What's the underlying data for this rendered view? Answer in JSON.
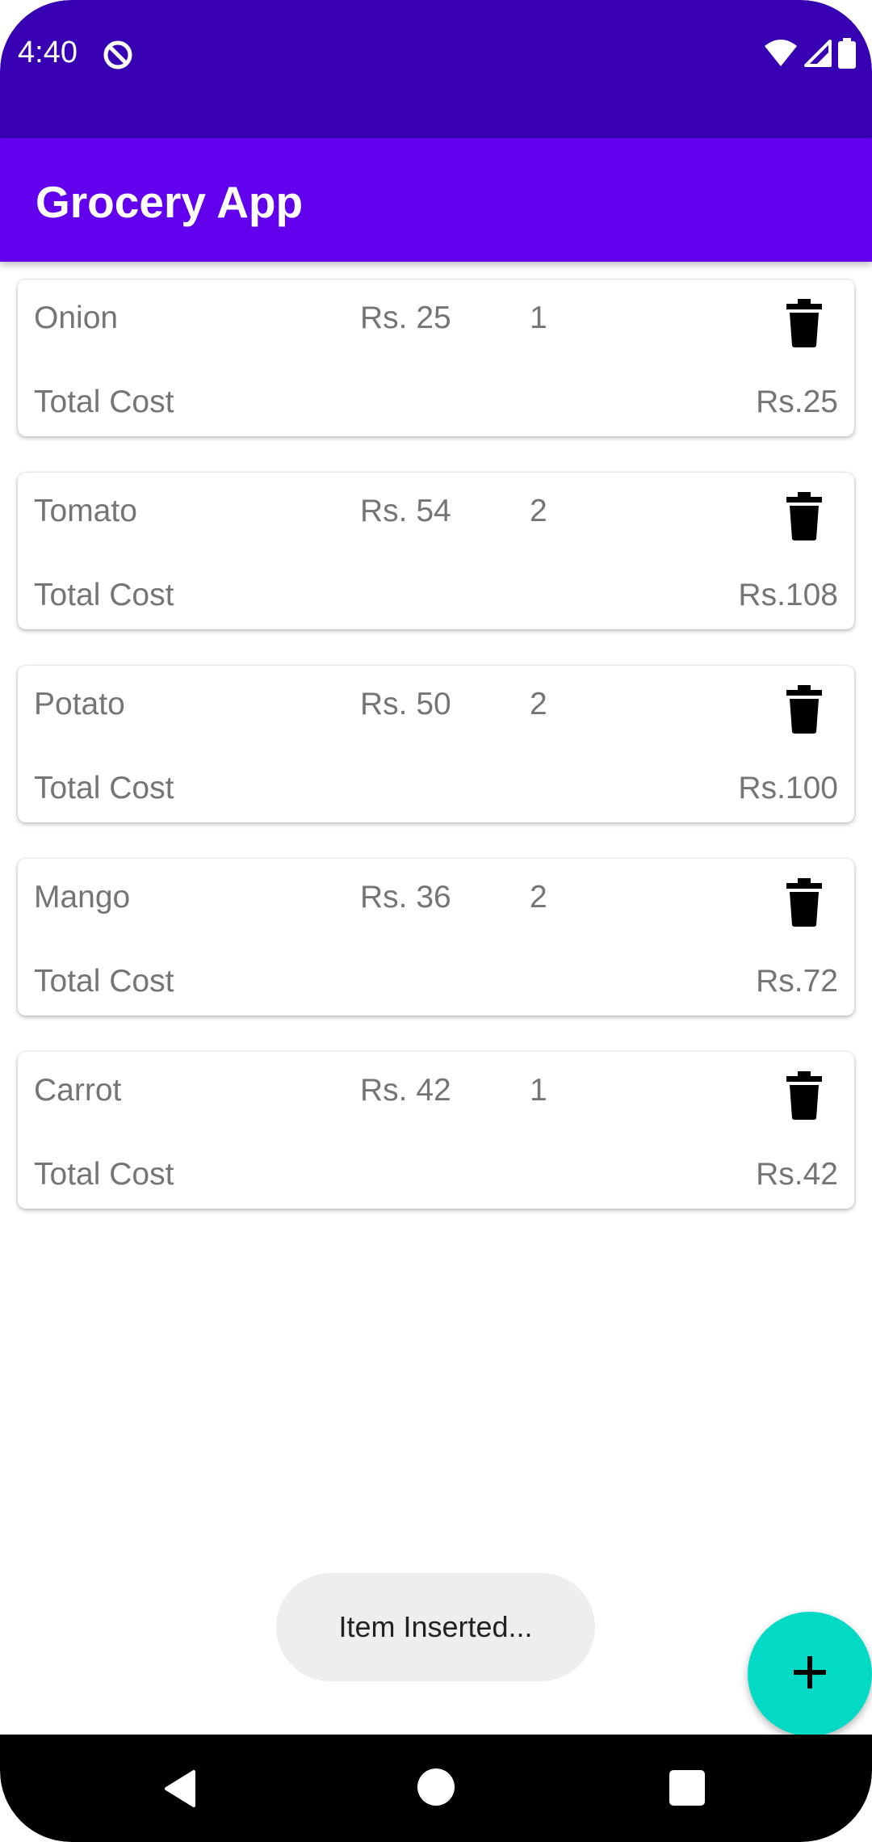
{
  "status_bar": {
    "time": "4:40",
    "icons": [
      "sync-icon",
      "wifi-icon",
      "signal-icon",
      "battery-icon"
    ]
  },
  "app_bar": {
    "title": "Grocery App"
  },
  "colors": {
    "status_bar": "#3700B3",
    "app_bar": "#6200EE",
    "fab": "#03DAC5",
    "text_secondary": "#757575"
  },
  "items": [
    {
      "name": "Onion",
      "price": "Rs. 25",
      "quantity": "1",
      "total_label": "Total Cost",
      "total": "Rs.25"
    },
    {
      "name": "Tomato",
      "price": "Rs. 54",
      "quantity": "2",
      "total_label": "Total Cost",
      "total": "Rs.108"
    },
    {
      "name": "Potato",
      "price": "Rs. 50",
      "quantity": "2",
      "total_label": "Total Cost",
      "total": "Rs.100"
    },
    {
      "name": "Mango",
      "price": "Rs. 36",
      "quantity": "2",
      "total_label": "Total Cost",
      "total": "Rs.72"
    },
    {
      "name": "Carrot",
      "price": "Rs. 42",
      "quantity": "1",
      "total_label": "Total Cost",
      "total": "Rs.42"
    }
  ],
  "toast": {
    "message": "Item Inserted..."
  },
  "fab": {
    "icon": "plus-icon"
  },
  "nav_bar": {
    "icons": [
      "back-icon",
      "home-icon",
      "recents-icon"
    ]
  }
}
